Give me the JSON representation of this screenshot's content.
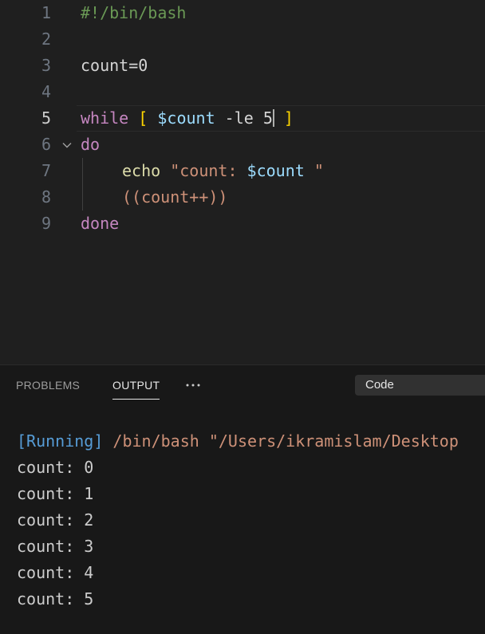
{
  "editor": {
    "lines": [
      {
        "num": "1",
        "text": "#!/bin/bash"
      },
      {
        "num": "2",
        "text": ""
      },
      {
        "num": "3",
        "text": "count=0"
      },
      {
        "num": "4",
        "text": ""
      },
      {
        "num": "5",
        "tokens": [
          "while",
          "[",
          "$count",
          "-le 5",
          "]"
        ]
      },
      {
        "num": "6",
        "text": "do"
      },
      {
        "num": "7",
        "tokens": [
          "echo",
          "\"count: ",
          "$count",
          " \""
        ]
      },
      {
        "num": "8",
        "tokens": [
          "((",
          "count++",
          "))"
        ]
      },
      {
        "num": "9",
        "text": "done"
      }
    ],
    "current_line": "5"
  },
  "panel": {
    "tabs": [
      {
        "label": "PROBLEMS",
        "active": false
      },
      {
        "label": "OUTPUT",
        "active": true
      }
    ],
    "more_icon": "ellipsis-icon",
    "channel_select": "Code",
    "output": {
      "running_tag": "[Running]",
      "running_cmd": " /bin/bash \"/Users/ikramislam/Desktop",
      "lines": [
        "count: 0",
        "count: 1",
        "count: 2",
        "count: 3",
        "count: 4",
        "count: 5"
      ]
    }
  },
  "colors": {
    "background": "#1f1f1f",
    "comment": "#6a9955",
    "keyword": "#c586c0",
    "variable": "#9cdcfe",
    "string": "#ce9178",
    "bracket": "#ffd700",
    "function": "#dcdcaa"
  }
}
